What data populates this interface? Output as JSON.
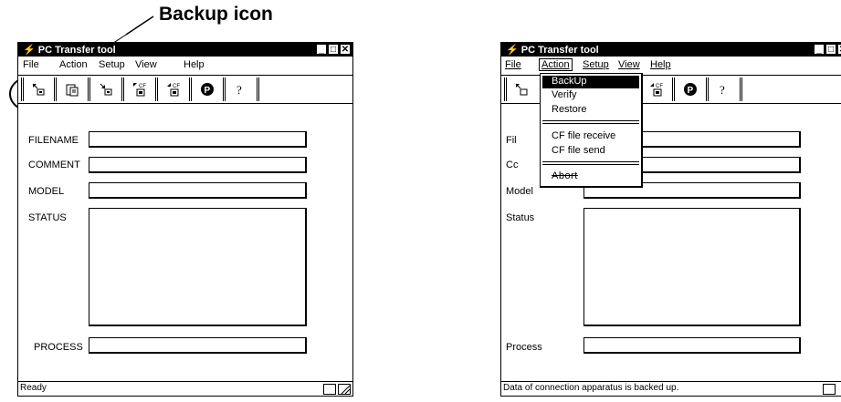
{
  "callout": {
    "label": "Backup icon"
  },
  "left_window": {
    "title": "PC Transfer tool",
    "menu": [
      "File",
      "Action",
      "Setup",
      "View",
      "Help"
    ],
    "toolbar_icons": [
      "backup-icon",
      "clipboard-icon",
      "restore-icon",
      "cf-receive-icon",
      "cf-send-icon",
      "p-icon",
      "help-icon"
    ],
    "fields": {
      "filename": "FILENAME",
      "comment": "COMMENT",
      "model": "MODEL",
      "status": "STATUS",
      "process": "PROCESS"
    },
    "status_text": "Ready"
  },
  "right_window": {
    "title": "PC Transfer tool",
    "menu": [
      "File",
      "Action",
      "Setup",
      "View",
      "Help"
    ],
    "toolbar_icons": [
      "backup-icon",
      "clipboard-icon",
      "restore-icon",
      "cf-receive-icon",
      "cf-send-icon",
      "p-icon",
      "help-icon"
    ],
    "action_menu": {
      "items": [
        "BackUp",
        "Verify",
        "Restore",
        "CF file receive",
        "CF file send",
        "Abort"
      ]
    },
    "fields": {
      "filename_partial": "Fil",
      "comment_partial": "Cc",
      "model_partial": "Model",
      "status": "Status",
      "process": "Process"
    },
    "status_text": "Data of connection apparatus is backed up."
  }
}
